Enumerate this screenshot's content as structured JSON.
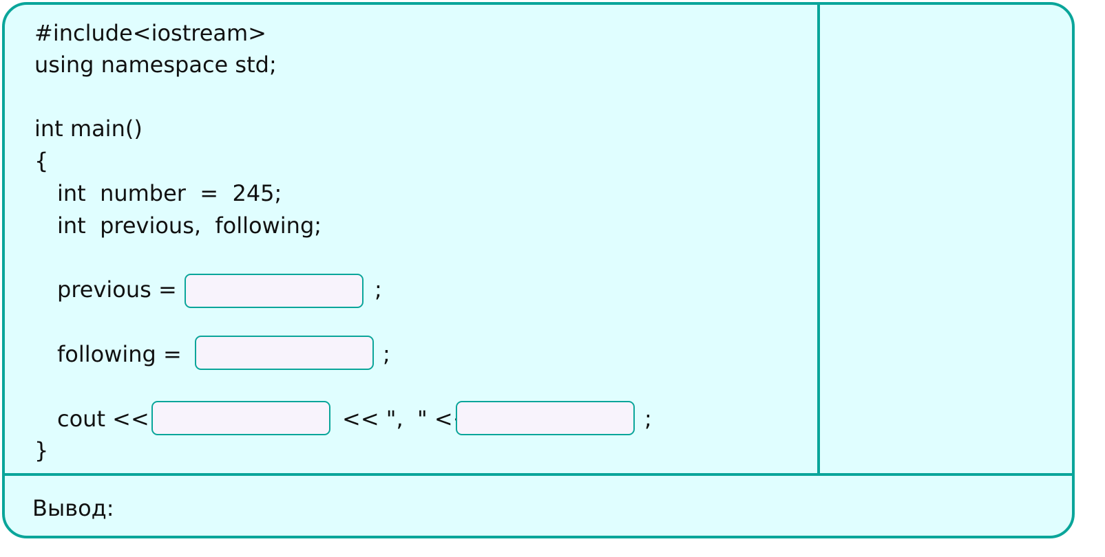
{
  "code": {
    "include": "#include<iostream>",
    "using": "using namespace std;",
    "main_sig": "int main()",
    "open_brace": "{",
    "decl_number": "int  number  =  245;",
    "decl_vars": "int  previous,  following;",
    "prev_lhs": "previous =",
    "prev_semi": ";",
    "follow_lhs": "following =",
    "follow_semi": ";",
    "cout_lhs": "cout <<",
    "cout_mid": "<< \",  \" <<",
    "cout_semi": ";",
    "close_brace": "}"
  },
  "blanks": {
    "previous_value": "",
    "following_value": "",
    "cout_first_value": "",
    "cout_second_value": ""
  },
  "output": {
    "label": "Вывод:"
  },
  "colors": {
    "accent": "#0aa59a",
    "panel_background": "#e0feff",
    "blank_background": "#f8f3fc"
  }
}
